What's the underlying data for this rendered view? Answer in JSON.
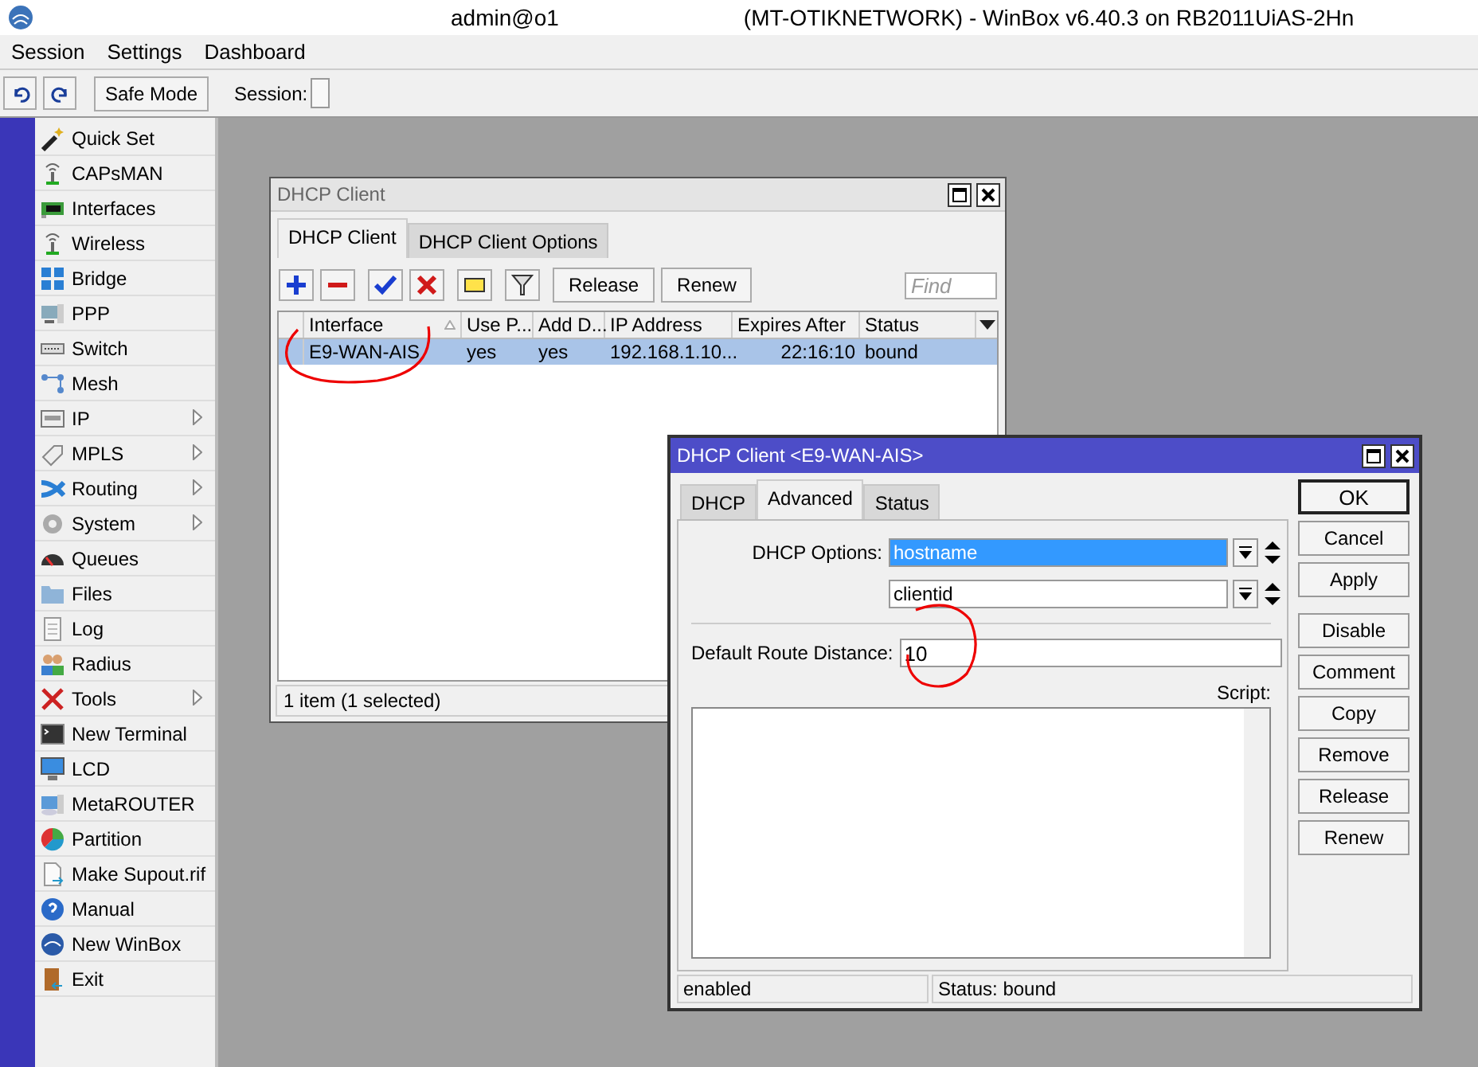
{
  "window": {
    "title_parts": [
      "admin@o1",
      "(MT-OTIKNETWORK) - WinBox v6.40.3 on RB2011UiAS-2Hn"
    ]
  },
  "menu": [
    "Session",
    "Settings",
    "Dashboard"
  ],
  "toolbar": {
    "safe_mode": "Safe Mode",
    "session_label": "Session:"
  },
  "sidebar": {
    "items": [
      {
        "label": "Quick Set",
        "has_submenu": false
      },
      {
        "label": "CAPsMAN",
        "has_submenu": false
      },
      {
        "label": "Interfaces",
        "has_submenu": false
      },
      {
        "label": "Wireless",
        "has_submenu": false
      },
      {
        "label": "Bridge",
        "has_submenu": false
      },
      {
        "label": "PPP",
        "has_submenu": false
      },
      {
        "label": "Switch",
        "has_submenu": false
      },
      {
        "label": "Mesh",
        "has_submenu": false
      },
      {
        "label": "IP",
        "has_submenu": true
      },
      {
        "label": "MPLS",
        "has_submenu": true
      },
      {
        "label": "Routing",
        "has_submenu": true
      },
      {
        "label": "System",
        "has_submenu": true
      },
      {
        "label": "Queues",
        "has_submenu": false
      },
      {
        "label": "Files",
        "has_submenu": false
      },
      {
        "label": "Log",
        "has_submenu": false
      },
      {
        "label": "Radius",
        "has_submenu": false
      },
      {
        "label": "Tools",
        "has_submenu": true
      },
      {
        "label": "New Terminal",
        "has_submenu": false
      },
      {
        "label": "LCD",
        "has_submenu": false
      },
      {
        "label": "MetaROUTER",
        "has_submenu": false
      },
      {
        "label": "Partition",
        "has_submenu": false
      },
      {
        "label": "Make Supout.rif",
        "has_submenu": false
      },
      {
        "label": "Manual",
        "has_submenu": false
      },
      {
        "label": "New WinBox",
        "has_submenu": false
      },
      {
        "label": "Exit",
        "has_submenu": false
      }
    ]
  },
  "dhcp_window": {
    "title": "DHCP Client",
    "tabs": [
      {
        "label": "DHCP Client",
        "selected": true
      },
      {
        "label": "DHCP Client Options",
        "selected": false
      }
    ],
    "buttons": [
      "Release",
      "Renew"
    ],
    "find": {
      "placeholder": "Find"
    },
    "table": {
      "columns": [
        {
          "label": "Interface",
          "sorted": true
        },
        {
          "label": "Use P...",
          "sorted": false
        },
        {
          "label": "Add D...",
          "sorted": false
        },
        {
          "label": "IP Address",
          "sorted": false
        },
        {
          "label": "Expires After",
          "sorted": false
        },
        {
          "label": "Status",
          "sorted": false
        }
      ],
      "rows": [
        {
          "cells": [
            "E9-WAN-AIS",
            "yes",
            "yes",
            "192.168.1.10...",
            "22:16:10",
            "bound"
          ],
          "selected": true
        }
      ]
    },
    "status_bar": "1 item (1 selected)"
  },
  "dialog": {
    "title": "DHCP Client <E9-WAN-AIS>",
    "tabs": [
      {
        "label": "DHCP",
        "selected": false
      },
      {
        "label": "Advanced",
        "selected": true
      },
      {
        "label": "Status",
        "selected": false
      }
    ],
    "dhcp_options_label": "DHCP Options:",
    "dhcp_options": [
      {
        "value": "hostname",
        "selected": true
      },
      {
        "value": "clientid",
        "selected": false
      }
    ],
    "distance": {
      "label": "Default Route Distance:",
      "value": "10"
    },
    "script_label": "Script:",
    "button_groups": [
      [
        {
          "label": "OK",
          "default": true
        },
        {
          "label": "Cancel",
          "default": false
        },
        {
          "label": "Apply",
          "default": false
        }
      ],
      [
        {
          "label": "Disable",
          "default": false
        },
        {
          "label": "Comment",
          "default": false
        },
        {
          "label": "Copy",
          "default": false
        },
        {
          "label": "Remove",
          "default": false
        },
        {
          "label": "Release",
          "default": false
        },
        {
          "label": "Renew",
          "default": false
        }
      ]
    ],
    "status_bar": [
      "enabled",
      "Status: bound"
    ]
  }
}
